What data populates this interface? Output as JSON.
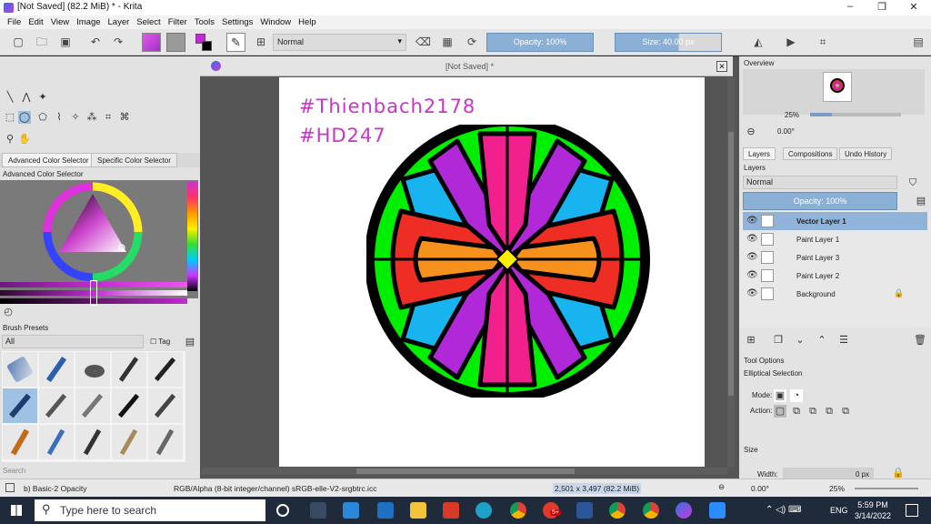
{
  "window": {
    "title": "[Not Saved]  (82.2 MiB)  * - Krita"
  },
  "menu": [
    "File",
    "Edit",
    "View",
    "Image",
    "Layer",
    "Select",
    "Filter",
    "Tools",
    "Settings",
    "Window",
    "Help"
  ],
  "toolbar": {
    "blend_mode": "Normal",
    "opacity_label": "Opacity: 100%",
    "size_label": "Size: 40.00 px",
    "fg_color": "#c02bd1",
    "bg_color": "#000000"
  },
  "left_dock": {
    "color_tabs": [
      "Advanced Color Selector",
      "Specific Color Selector"
    ],
    "color_selector_title": "Advanced Color Selector",
    "brush_presets_title": "Brush Presets",
    "brush_filter": "All",
    "tag_label": "Tag",
    "search_placeholder": "Search"
  },
  "canvas": {
    "tab_title": "[Not Saved]  *",
    "text_line1": "#Thienbach2178",
    "text_line2": "#HD247"
  },
  "right_dock": {
    "overview_title": "Overview",
    "zoom_percent": "25%",
    "rotation": "0.00°",
    "tabs": [
      "Layers",
      "Compositions",
      "Undo History"
    ],
    "layers_title": "Layers",
    "layers_blend": "Normal",
    "layers_opacity": "Opacity:  100%",
    "layers": [
      "Vector Layer 1",
      "Paint Layer 1",
      "Paint Layer 3",
      "Paint Layer 2",
      "Background"
    ],
    "tool_options_title": "Tool Options",
    "tool_name": "Elliptical Selection",
    "mode_label": "Mode:",
    "action_label": "Action:",
    "size_title": "Size",
    "width_label": "Width:",
    "width_value": "0 px"
  },
  "status": {
    "brush": "b) Basic-2 Opacity",
    "colorspace": "RGB/Alpha (8-bit integer/channel)  sRGB-elle-V2-srgbtrc.icc",
    "image_size": "2,501 x 3,497 (82.2 MiB)",
    "rotation": "0.00°",
    "zoom": "25%"
  },
  "taskbar": {
    "search_placeholder": "Type here to search",
    "time": "5:59 PM",
    "date": "3/14/2022",
    "language": "ENG",
    "notification_count": "5+"
  }
}
